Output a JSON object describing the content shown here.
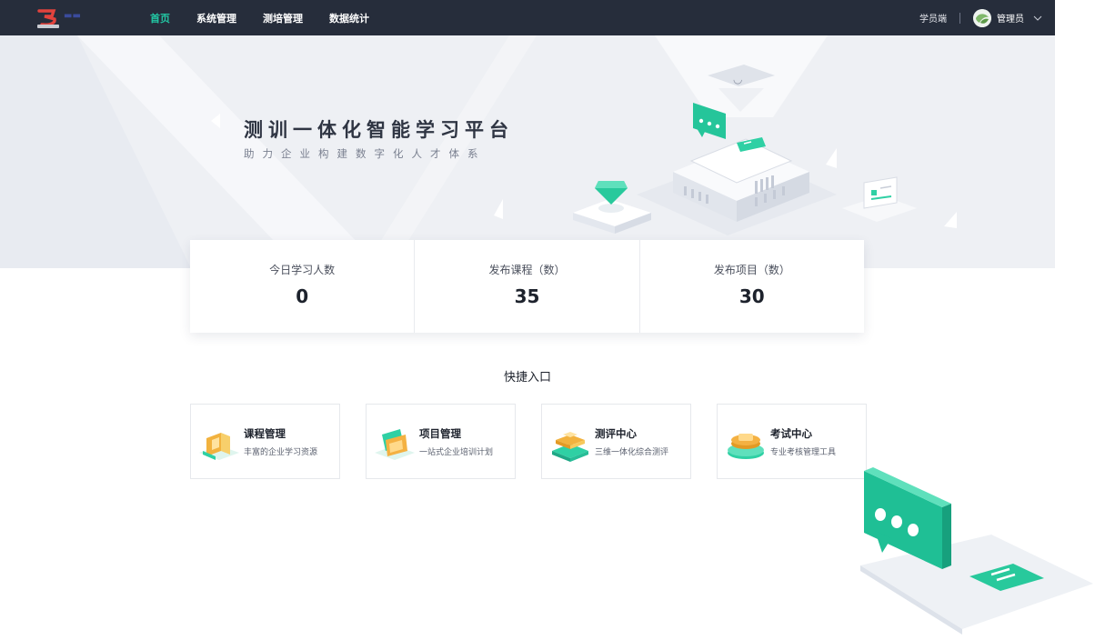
{
  "header": {
    "nav": [
      {
        "label": "首页",
        "active": true
      },
      {
        "label": "系统管理",
        "active": false
      },
      {
        "label": "测培管理",
        "active": false
      },
      {
        "label": "数据统计",
        "active": false
      }
    ],
    "student_link": "学员端",
    "user_name": "管理员",
    "icons": [
      "logo-icon",
      "avatar-icon",
      "chevron-down-icon"
    ]
  },
  "banner": {
    "title": "测训一体化智能学习平台",
    "subtitle": "助力企业构建数字化人才体系"
  },
  "stats": [
    {
      "label": "今日学习人数",
      "value": "0"
    },
    {
      "label": "发布课程（数）",
      "value": "35"
    },
    {
      "label": "发布项目（数）",
      "value": "30"
    }
  ],
  "quick": {
    "title": "快捷入口",
    "items": [
      {
        "title": "课程管理",
        "desc": "丰富的企业学习资源",
        "icon": "course-icon"
      },
      {
        "title": "项目管理",
        "desc": "一站式企业培训计划",
        "icon": "project-icon"
      },
      {
        "title": "测评中心",
        "desc": "三维一体化综合测评",
        "icon": "assessment-icon"
      },
      {
        "title": "考试中心",
        "desc": "专业考核管理工具",
        "icon": "exam-icon"
      }
    ]
  },
  "colors": {
    "topbar": "#262d3b",
    "accent": "#22c7a4",
    "banner_bg": "#eef0f4"
  }
}
